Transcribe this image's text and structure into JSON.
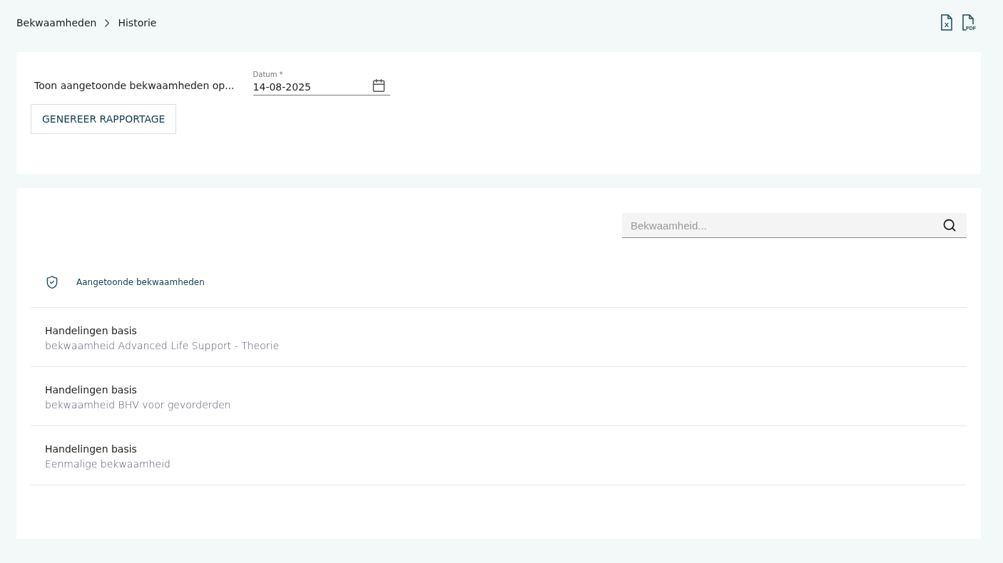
{
  "breadcrumb": [
    "Bekwaamheden",
    "Historie"
  ],
  "export_buttons": [
    {
      "kind": "excel",
      "label": "X"
    },
    {
      "kind": "pdf",
      "label": "PDF"
    }
  ],
  "report": {
    "prompt": "Toon aangetoonde bekwaamheden op...",
    "date_field": {
      "label": "Datum *",
      "value": "14-08-2025"
    },
    "button": "GENEREER RAPPORTAGE"
  },
  "search": {
    "placeholder": "Bekwaamheid..."
  },
  "section": {
    "title": "Aangetoonde bekwaamheden"
  },
  "items": [
    {
      "title": "Handelingen basis",
      "subtitle": "bekwaamheid Advanced Life Support - Theorie"
    },
    {
      "title": "Handelingen basis",
      "subtitle": "bekwaamheid BHV voor gevorderden"
    },
    {
      "title": "Handelingen basis",
      "subtitle": "Eenmalige bekwaamheid"
    }
  ]
}
